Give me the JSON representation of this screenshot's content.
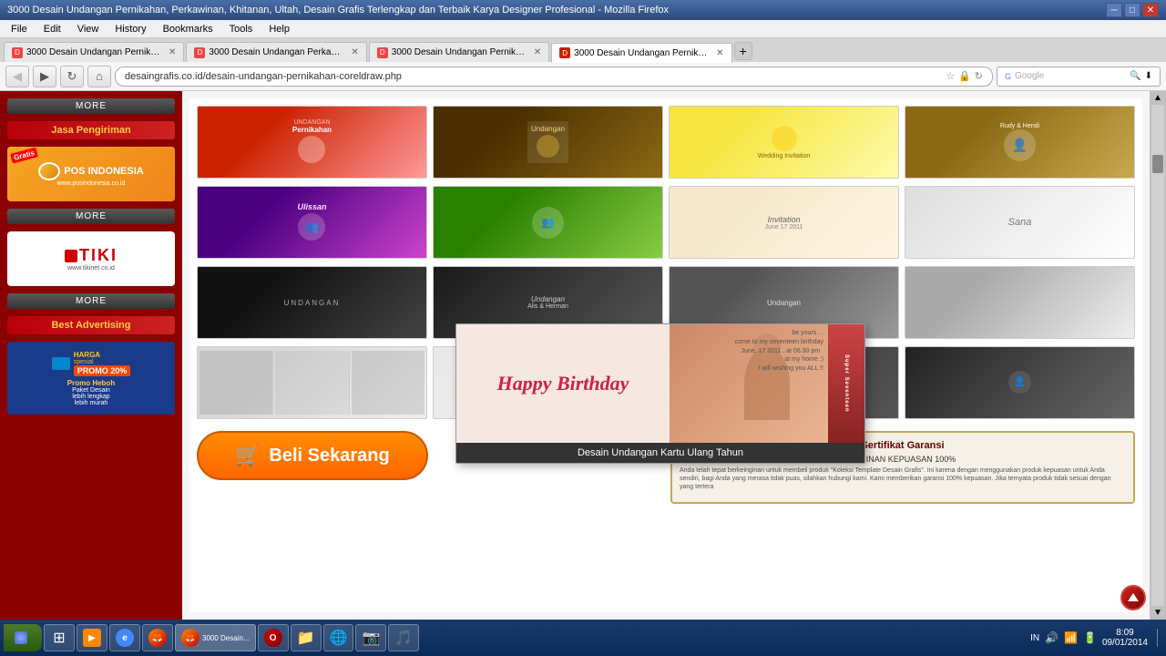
{
  "window": {
    "title": "3000 Desain Undangan Pernikahan, Perkawinan, Khitanan, Ultah, Desain Grafis Terlengkap dan Terbaik Karya Designer Profesional - Mozilla Firefox",
    "controls": [
      "─",
      "□",
      "✕"
    ]
  },
  "menu": {
    "items": [
      "File",
      "Edit",
      "View",
      "History",
      "Bookmarks",
      "Tools",
      "Help"
    ]
  },
  "tabs": [
    {
      "label": "3000 Desain Undangan Pernikahan, P...",
      "active": false,
      "favicon": "D"
    },
    {
      "label": "3000 Desain Undangan Perkawinan P...",
      "active": false,
      "favicon": "D"
    },
    {
      "label": "3000 Desain Undangan Pernikahan, P...",
      "active": false,
      "favicon": "D"
    },
    {
      "label": "3000 Desain Undangan Pernikahan, P...",
      "active": true,
      "favicon": "D"
    }
  ],
  "nav": {
    "url": "desaingrafis.co.id/desain-undangan-pernikahan-coreldraw.php",
    "search_placeholder": "Google"
  },
  "sidebar": {
    "shipping_title": "Jasa Pengiriman",
    "advertising_title": "Best Advertising",
    "more_label": "MORE",
    "pos_text": "POS INDONESIA",
    "pos_url": "",
    "tiki_name": "TIKI",
    "tiki_url": "www.tikinet.co.id",
    "gratis_label": "Gratis",
    "promo_title": "HARGA spesial PROMO 20%",
    "promo_sub1": "Promo Heboh",
    "promo_sub2": "Paket Desain",
    "promo_sub3": "lebih lengkap",
    "promo_sub4": "lebih murah"
  },
  "tooltip": {
    "title": "Desain Undangan Kartu Ulang Tahun",
    "happy_birthday": "Happy Birthday",
    "invitation_line1": "be yours ...",
    "invitation_line2": "come to my seventeen birthday",
    "invitation_line3": "June, 17 2011 , at 06.30 pm .",
    "invitation_line4": "at my home :)",
    "invitation_line5": "I will wishing you ALL !!",
    "super_seventeen": "Super Seventeen"
  },
  "content": {
    "buy_btn_label": "Beli Sekarang",
    "cert_title": "Sertifikat Garansi",
    "cert_subtitle": "JAMINAN KEPUASAN 100%",
    "cert_text1": "Anda telah tepat berkeinginan untuk membeli produk \"Koleksi Template Desain Grafis\". Ini karena dengan menggunakan produk kepuasan untuk Anda sendiri, bagi Anda yang merasa tidak puas, silahkan hubungi kami. Kami memberikan garansi 100% kepuasan. Jika ternyata produk tidak sesuai dengan yang tertera"
  },
  "status": {
    "locale": "IN",
    "time": "8:09",
    "date": "09/01/2014"
  },
  "taskbar": {
    "apps": [
      {
        "name": "Start",
        "type": "start"
      },
      {
        "name": "Windows",
        "type": "windows"
      },
      {
        "name": "Media",
        "type": "media"
      },
      {
        "name": "IE",
        "type": "ie"
      },
      {
        "name": "Firefox",
        "type": "firefox"
      },
      {
        "name": "Opera",
        "type": "opera"
      },
      {
        "name": "Folder",
        "type": "folder"
      },
      {
        "name": "Earth",
        "type": "earth"
      },
      {
        "name": "App1",
        "type": "app"
      },
      {
        "name": "App2",
        "type": "app"
      },
      {
        "name": "App3",
        "type": "app"
      }
    ]
  },
  "images": {
    "row1": [
      {
        "label": "Red Wedding",
        "style": "inv-red"
      },
      {
        "label": "Brown Wedding",
        "style": "inv-brown"
      },
      {
        "label": "Yellow Floral",
        "style": "inv-yellow"
      },
      {
        "label": "Wedding Photo",
        "style": "inv-wedding"
      }
    ],
    "row2": [
      {
        "label": "Purple Wedding",
        "style": "inv-purple"
      },
      {
        "label": "Green Wedding",
        "style": "inv-green"
      },
      {
        "label": "Cream Elegant",
        "style": "inv-cream"
      },
      {
        "label": "Modern",
        "style": "inv-dark"
      }
    ],
    "row3": [
      {
        "label": "Black Elegant",
        "style": "inv-black"
      },
      {
        "label": "Dark Gray",
        "style": "inv-darkred"
      },
      {
        "label": "Gray Modern",
        "style": "inv-gray"
      },
      {
        "label": "placeholder",
        "style": "inv-bw"
      }
    ],
    "row4": [
      {
        "label": "Trifold White",
        "style": "inv-trifold"
      },
      {
        "label": "Column Style",
        "style": "inv-column"
      },
      {
        "label": "Dark Wedding",
        "style": "inv-darkred"
      },
      {
        "label": "Portrait BW",
        "style": "inv-dark"
      }
    ]
  }
}
